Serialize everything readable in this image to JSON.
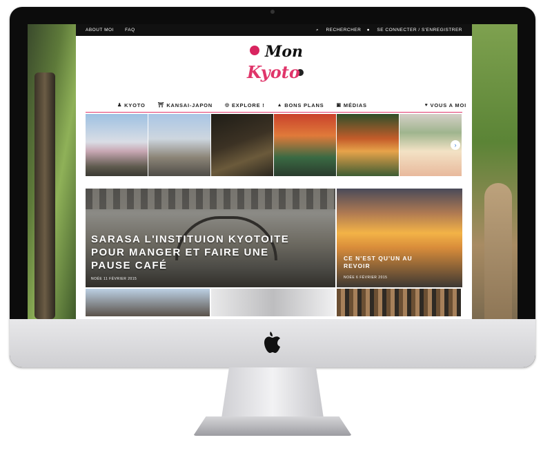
{
  "topbar": {
    "left": [
      "ABOUT MOI",
      "FAQ"
    ],
    "right": [
      "RECHERCHER",
      "SE CONNECTER / S'ENREGISTRER"
    ]
  },
  "brand": {
    "line1": "Mon",
    "line2": "Kyoto"
  },
  "nav": {
    "items": [
      {
        "label": "KYOTO",
        "icon": "person-icon"
      },
      {
        "label": "KANSAI-JAPON",
        "icon": "torii-icon"
      },
      {
        "label": "EXPLORE !",
        "icon": "compass-icon"
      },
      {
        "label": "BONS PLANS",
        "icon": "thumbs-up-icon"
      },
      {
        "label": "MÉDIAS",
        "icon": "media-icon"
      }
    ],
    "vous": {
      "label": "VOUS A MOI",
      "icon": "heart-icon"
    }
  },
  "slider": {
    "next_icon": "chevron-right-icon",
    "next_glyph": "›"
  },
  "feature": {
    "title": "SARASA L'INSTITUION KYOTOITE POUR MANGER ET FAIRE UNE PAUSE CAFÉ",
    "meta": "NOÉE  11 FÉVRIER 2015"
  },
  "side": {
    "title": "CE N'EST QU'UN AU REVOIR",
    "meta": "NOÉE  6 FÉVRIER 2015"
  },
  "colors": {
    "accent": "#e0356a",
    "topbar": "#111111"
  }
}
